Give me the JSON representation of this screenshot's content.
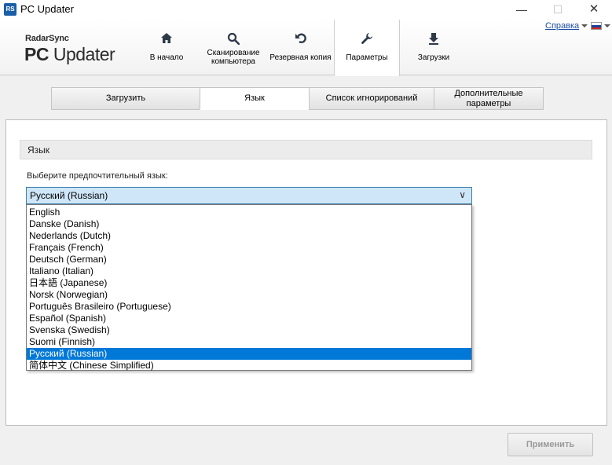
{
  "window": {
    "icon_text": "RS",
    "title": "PC Updater",
    "minimize_glyph": "—",
    "maximize_glyph": "☐",
    "close_glyph": "✕"
  },
  "header": {
    "logo_small": "RadarSync",
    "logo_big_bold": "PC",
    "logo_big_rest": " Updater",
    "help_link": "Справка",
    "nav": [
      {
        "label": "В начало",
        "icon": "home-icon"
      },
      {
        "label": "Сканирование компьютера",
        "icon": "search-icon"
      },
      {
        "label": "Резервная копия",
        "icon": "undo-icon"
      },
      {
        "label": "Параметры",
        "icon": "wrench-icon",
        "active": true
      },
      {
        "label": "Загрузки",
        "icon": "download-icon"
      }
    ],
    "flag_colors": [
      "#ffffff",
      "#1c3f9e",
      "#d52b1e"
    ]
  },
  "subtabs": [
    {
      "label": "Загрузить"
    },
    {
      "label": "Язык",
      "active": true
    },
    {
      "label": "Список игнорирований"
    },
    {
      "label": "Дополнительные параметры"
    }
  ],
  "panel": {
    "section_title": "Язык",
    "choose_label": "Выберите предпочтительный язык:",
    "selected_language": "Русский (Russian)",
    "chevron": "∨",
    "languages": [
      "English",
      "Danske (Danish)",
      "Nederlands (Dutch)",
      "Français (French)",
      "Deutsch (German)",
      "Italiano (Italian)",
      "日本語 (Japanese)",
      "Norsk (Norwegian)",
      "Português Brasileiro (Portuguese)",
      "Español (Spanish)",
      "Svenska (Swedish)",
      "Suomi (Finnish)",
      "Русский (Russian)",
      "简体中文 (Chinese Simplified)"
    ],
    "selected_index": 12
  },
  "apply_button": "Применить",
  "colors": {
    "accent": "#0078d7",
    "select_bg": "#cfe6f8",
    "link": "#1d4ea3"
  }
}
